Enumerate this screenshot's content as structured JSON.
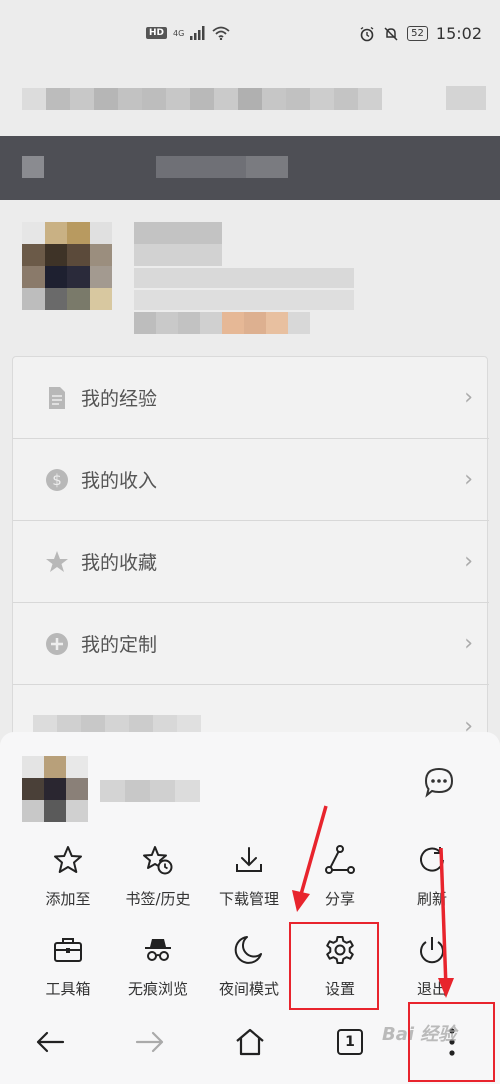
{
  "status_bar": {
    "network_badge": "HD",
    "network_type": "4G",
    "battery": "52",
    "time": "15:02"
  },
  "profile_list": [
    {
      "label": "我的经验",
      "icon": "document-icon"
    },
    {
      "label": "我的收入",
      "icon": "dollar-icon"
    },
    {
      "label": "我的收藏",
      "icon": "star-icon"
    },
    {
      "label": "我的定制",
      "icon": "plus-circle-icon"
    }
  ],
  "menu": {
    "row1": [
      {
        "label": "添加至",
        "icon": "star-outline-icon"
      },
      {
        "label": "书签/历史",
        "icon": "bookmark-history-icon"
      },
      {
        "label": "下载管理",
        "icon": "download-icon"
      },
      {
        "label": "分享",
        "icon": "share-icon"
      },
      {
        "label": "刷新",
        "icon": "refresh-icon"
      }
    ],
    "row2": [
      {
        "label": "工具箱",
        "icon": "toolbox-icon"
      },
      {
        "label": "无痕浏览",
        "icon": "incognito-icon"
      },
      {
        "label": "夜间模式",
        "icon": "moon-icon"
      },
      {
        "label": "设置",
        "icon": "gear-icon"
      },
      {
        "label": "退出",
        "icon": "power-icon"
      }
    ]
  },
  "navbar": {
    "tab_count": "1"
  },
  "watermark": "Bai 经验",
  "colors": {
    "highlight": "#e8242d",
    "sheet_bg": "#f7f7f8"
  }
}
